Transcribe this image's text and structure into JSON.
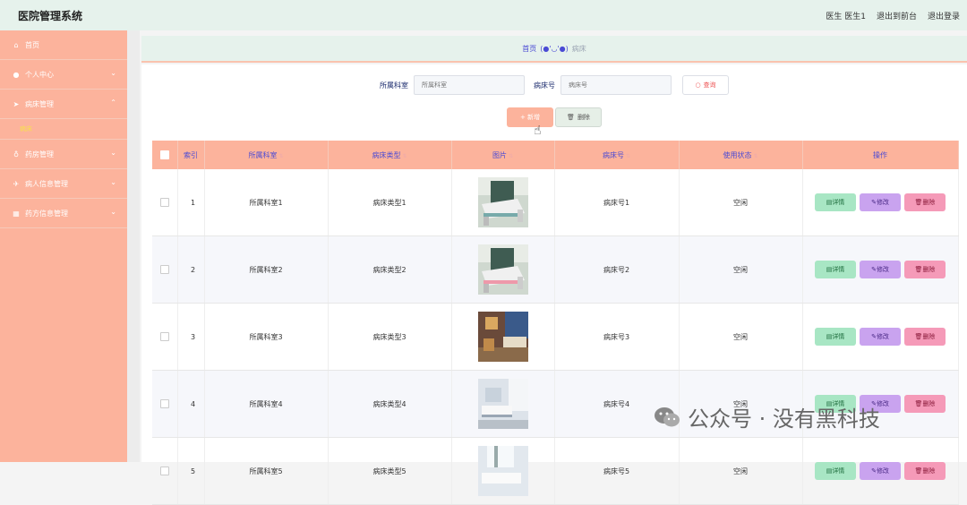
{
  "header": {
    "title": "医院管理系统",
    "user": "医生 医生1",
    "front_link": "退出到前台",
    "logout": "退出登录"
  },
  "sidebar": {
    "items": [
      {
        "label": "首页",
        "icon": "home-icon"
      },
      {
        "label": "个人中心",
        "icon": "user-icon"
      },
      {
        "label": "病床管理",
        "icon": "send-icon"
      },
      {
        "label": "病床",
        "icon": ""
      },
      {
        "label": "药房管理",
        "icon": "mic-icon"
      },
      {
        "label": "病人信息管理",
        "icon": "plane-icon"
      },
      {
        "label": "药方信息管理",
        "icon": "grid-icon"
      }
    ]
  },
  "breadcrumb": {
    "home": "首页",
    "separator": "(●'◡'●)",
    "current": "病床"
  },
  "search": {
    "dept_label": "所属科室",
    "dept_placeholder": "所属科室",
    "bed_label": "病床号",
    "bed_placeholder": "病床号",
    "query_button": "查询"
  },
  "actions": {
    "add": "+ 新增",
    "delete": "删除"
  },
  "table": {
    "headers": [
      "索引",
      "所属科室",
      "病床类型",
      "图片",
      "病床号",
      "使用状态",
      "操作"
    ],
    "rows": [
      {
        "index": "1",
        "dept": "所属科室1",
        "type": "病床类型1",
        "bed": "病床号1",
        "status": "空闲"
      },
      {
        "index": "2",
        "dept": "所属科室2",
        "type": "病床类型2",
        "bed": "病床号2",
        "status": "空闲"
      },
      {
        "index": "3",
        "dept": "所属科室3",
        "type": "病床类型3",
        "bed": "病床号3",
        "status": "空闲"
      },
      {
        "index": "4",
        "dept": "所属科室4",
        "type": "病床类型4",
        "bed": "病床号4",
        "status": "空闲"
      },
      {
        "index": "5",
        "dept": "所属科室5",
        "type": "病床类型5",
        "bed": "病床号5",
        "status": "空闲"
      }
    ],
    "op_detail": "详情",
    "op_edit": "修改",
    "op_delete": "删除"
  },
  "watermark": {
    "text": "公众号 · 没有黑科技"
  },
  "colors": {
    "sidebar": "#fcb39c",
    "header": "#e6f2ec",
    "accent_blue": "#4a4ad4",
    "detail_btn": "#a8e6c4",
    "edit_btn": "#c9a3ef",
    "delete_btn": "#f59ab8"
  }
}
